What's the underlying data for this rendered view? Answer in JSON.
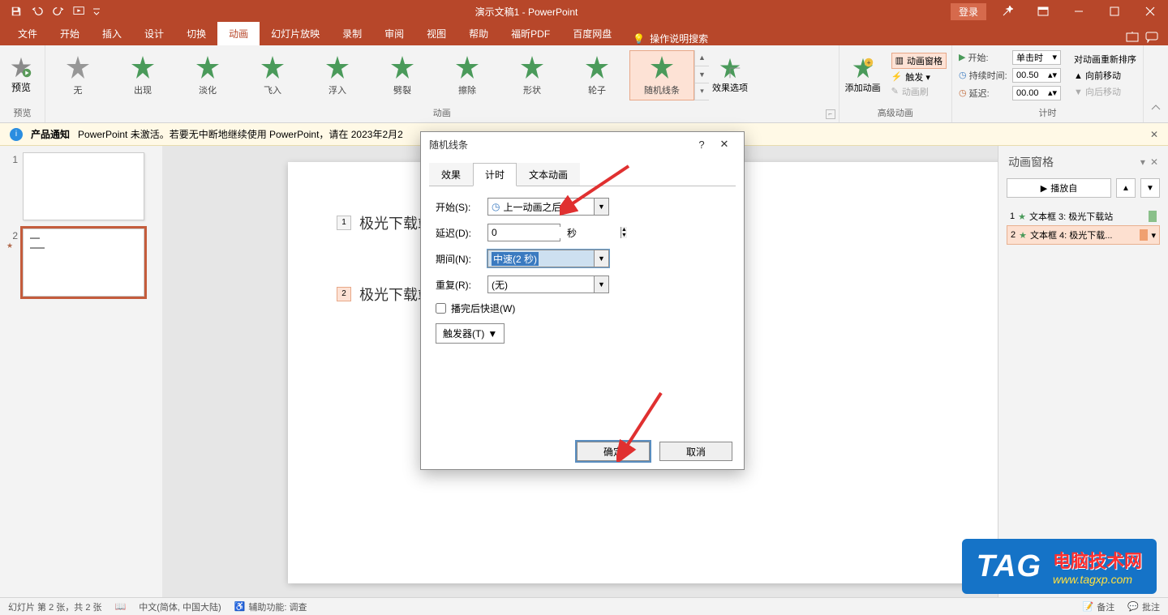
{
  "title": "演示文稿1 - PowerPoint",
  "login_label": "登录",
  "tabs": [
    "文件",
    "开始",
    "插入",
    "设计",
    "切换",
    "动画",
    "幻灯片放映",
    "录制",
    "审阅",
    "视图",
    "帮助",
    "福昕PDF",
    "百度网盘"
  ],
  "active_tab_index": 5,
  "tell_me": "操作说明搜索",
  "ribbon": {
    "preview": {
      "label": "预览",
      "group": "预览"
    },
    "gallery": {
      "items": [
        "无",
        "出现",
        "淡化",
        "飞入",
        "浮入",
        "劈裂",
        "擦除",
        "形状",
        "轮子",
        "随机线条"
      ],
      "selected_index": 9,
      "group": "动画"
    },
    "effect_options": "效果选项",
    "advanced": {
      "add": "添加动画",
      "pane": "动画窗格",
      "trigger": "触发 ▾",
      "painter": "动画刷",
      "group": "高级动画"
    },
    "timing": {
      "start_label": "开始:",
      "start_value": "单击时",
      "duration_label": "持续时间:",
      "duration_value": "00.50",
      "delay_label": "延迟:",
      "delay_value": "00.00",
      "reorder_label": "对动画重新排序",
      "move_earlier": "向前移动",
      "move_later": "向后移动",
      "group": "计时"
    }
  },
  "notice": {
    "title": "产品通知",
    "text": "PowerPoint 未激活。若要无中断地继续使用 PowerPoint，请在 2023年2月2"
  },
  "thumbs": {
    "slides": [
      {
        "num": "1"
      },
      {
        "num": "2"
      }
    ]
  },
  "slide": {
    "text1_tag": "1",
    "text1": "极光下载站",
    "text2_tag": "2",
    "text2": "极光下载站2"
  },
  "anim_pane": {
    "title": "动画窗格",
    "play": "播放自",
    "items": [
      {
        "idx": "1",
        "label": "文本框 3: 极光下载站"
      },
      {
        "idx": "2",
        "label": "文本框 4: 极光下载..."
      }
    ]
  },
  "dialog": {
    "title": "随机线条",
    "tabs": [
      "效果",
      "计时",
      "文本动画"
    ],
    "active_tab_index": 1,
    "start_label": "开始(S):",
    "start_value": "上一动画之后",
    "delay_label": "延迟(D):",
    "delay_value": "0",
    "delay_unit": "秒",
    "duration_label": "期间(N):",
    "duration_value": "中速(2 秒)",
    "repeat_label": "重复(R):",
    "repeat_value": "(无)",
    "rewind_label": "播完后快退(W)",
    "trigger_label": "触发器(T)",
    "ok": "确定",
    "cancel": "取消"
  },
  "status": {
    "slide_info": "幻灯片 第 2 张，共 2 张",
    "lang": "中文(简体, 中国大陆)",
    "access": "辅助功能: 调查",
    "notes": "备注",
    "comments": "批注"
  },
  "watermark": {
    "tag": "TAG",
    "line1": "电脑技术网",
    "line2": "www.tagxp.com"
  }
}
